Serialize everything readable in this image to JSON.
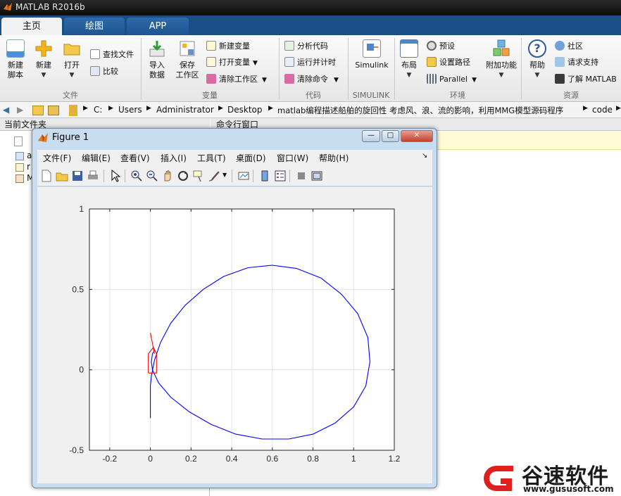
{
  "app": {
    "title": "MATLAB R2016b"
  },
  "tabs": [
    {
      "label": "主页"
    },
    {
      "label": "绘图"
    },
    {
      "label": "APP"
    }
  ],
  "ribbon": {
    "new_script": "新建\n脚本",
    "new": "新建",
    "open": "打开",
    "find_files": "查找文件",
    "compare": "比较",
    "import_data": "导入\n数据",
    "save_workspace": "保存\n工作区",
    "new_variable": "新建变量",
    "open_variable": "打开变量",
    "clear_workspace": "清除工作区",
    "analyze_code": "分析代码",
    "run_and_time": "运行并计时",
    "clear_commands": "清除命令",
    "simulink": "Simulink",
    "layout": "布局",
    "preferences": "预设",
    "set_path": "设置路径",
    "parallel": "Parallel",
    "add_ons": "附加功能",
    "help": "帮助",
    "community": "社区",
    "request_support": "请求支持",
    "learn_matlab": "了解 MATLAB",
    "groups": {
      "file": "文件",
      "variable": "变量",
      "code": "代码",
      "simulink": "SIMULINK",
      "environment": "环境",
      "resources": "资源"
    }
  },
  "address": {
    "path": [
      "C:",
      "Users",
      "Administrator",
      "Desktop",
      "matlab编程描述船舶的旋回性 考虑风、浪、流的影响，利用MMG模型源码程序",
      "code"
    ]
  },
  "panels": {
    "current_folder": "当前文件夹",
    "command_window": "命令行窗口",
    "file_letters": [
      "a",
      "r",
      "M"
    ]
  },
  "figure": {
    "title": "Figure 1",
    "menu": [
      "文件(F)",
      "编辑(E)",
      "查看(V)",
      "插入(I)",
      "工具(T)",
      "桌面(D)",
      "窗口(W)",
      "帮助(H)"
    ]
  },
  "chart_data": {
    "type": "line",
    "title": "",
    "xlabel": "",
    "ylabel": "",
    "xlim": [
      -0.3,
      1.2
    ],
    "ylim": [
      -0.5,
      1
    ],
    "xticks": [
      "-0.2",
      "0",
      "0.2",
      "0.4",
      "0.6",
      "0.8",
      "1",
      "1.2"
    ],
    "yticks": [
      "-0.5",
      "0",
      "0.5",
      "1"
    ],
    "grid": true,
    "series": [
      {
        "color": "#0000ff",
        "kind": "trajectory",
        "x": [
          0,
          0,
          0,
          0.005,
          0.02,
          0.05,
          0.1,
          0.17,
          0.26,
          0.36,
          0.48,
          0.6,
          0.72,
          0.84,
          0.94,
          1.02,
          1.07,
          1.08,
          1.06,
          1.0,
          0.91,
          0.8,
          0.68,
          0.55,
          0.42,
          0.3,
          0.19,
          0.1,
          0.04,
          0.01,
          0.005,
          0.01,
          0.02
        ],
        "y": [
          -0.3,
          -0.2,
          -0.1,
          -0.04,
          0.06,
          0.17,
          0.29,
          0.4,
          0.5,
          0.58,
          0.635,
          0.65,
          0.63,
          0.57,
          0.47,
          0.35,
          0.2,
          0.05,
          -0.1,
          -0.23,
          -0.33,
          -0.4,
          -0.43,
          -0.43,
          -0.4,
          -0.34,
          -0.26,
          -0.17,
          -0.08,
          0.0,
          0.05,
          0.1,
          0.12
        ]
      },
      {
        "color": "#ff0000",
        "kind": "ship-outline",
        "x": [
          -0.01,
          0.03,
          0.03,
          0.015,
          -0.01,
          -0.01
        ],
        "y": [
          -0.02,
          -0.02,
          0.1,
          0.14,
          0.1,
          -0.02
        ]
      },
      {
        "color": "#ff0000",
        "kind": "heading",
        "x": [
          0,
          0.02
        ],
        "y": [
          0.23,
          0.1
        ]
      }
    ]
  },
  "watermark": {
    "name": "谷速软件",
    "url": "www.gususoft.com",
    "brand_color": "#e0201f"
  }
}
